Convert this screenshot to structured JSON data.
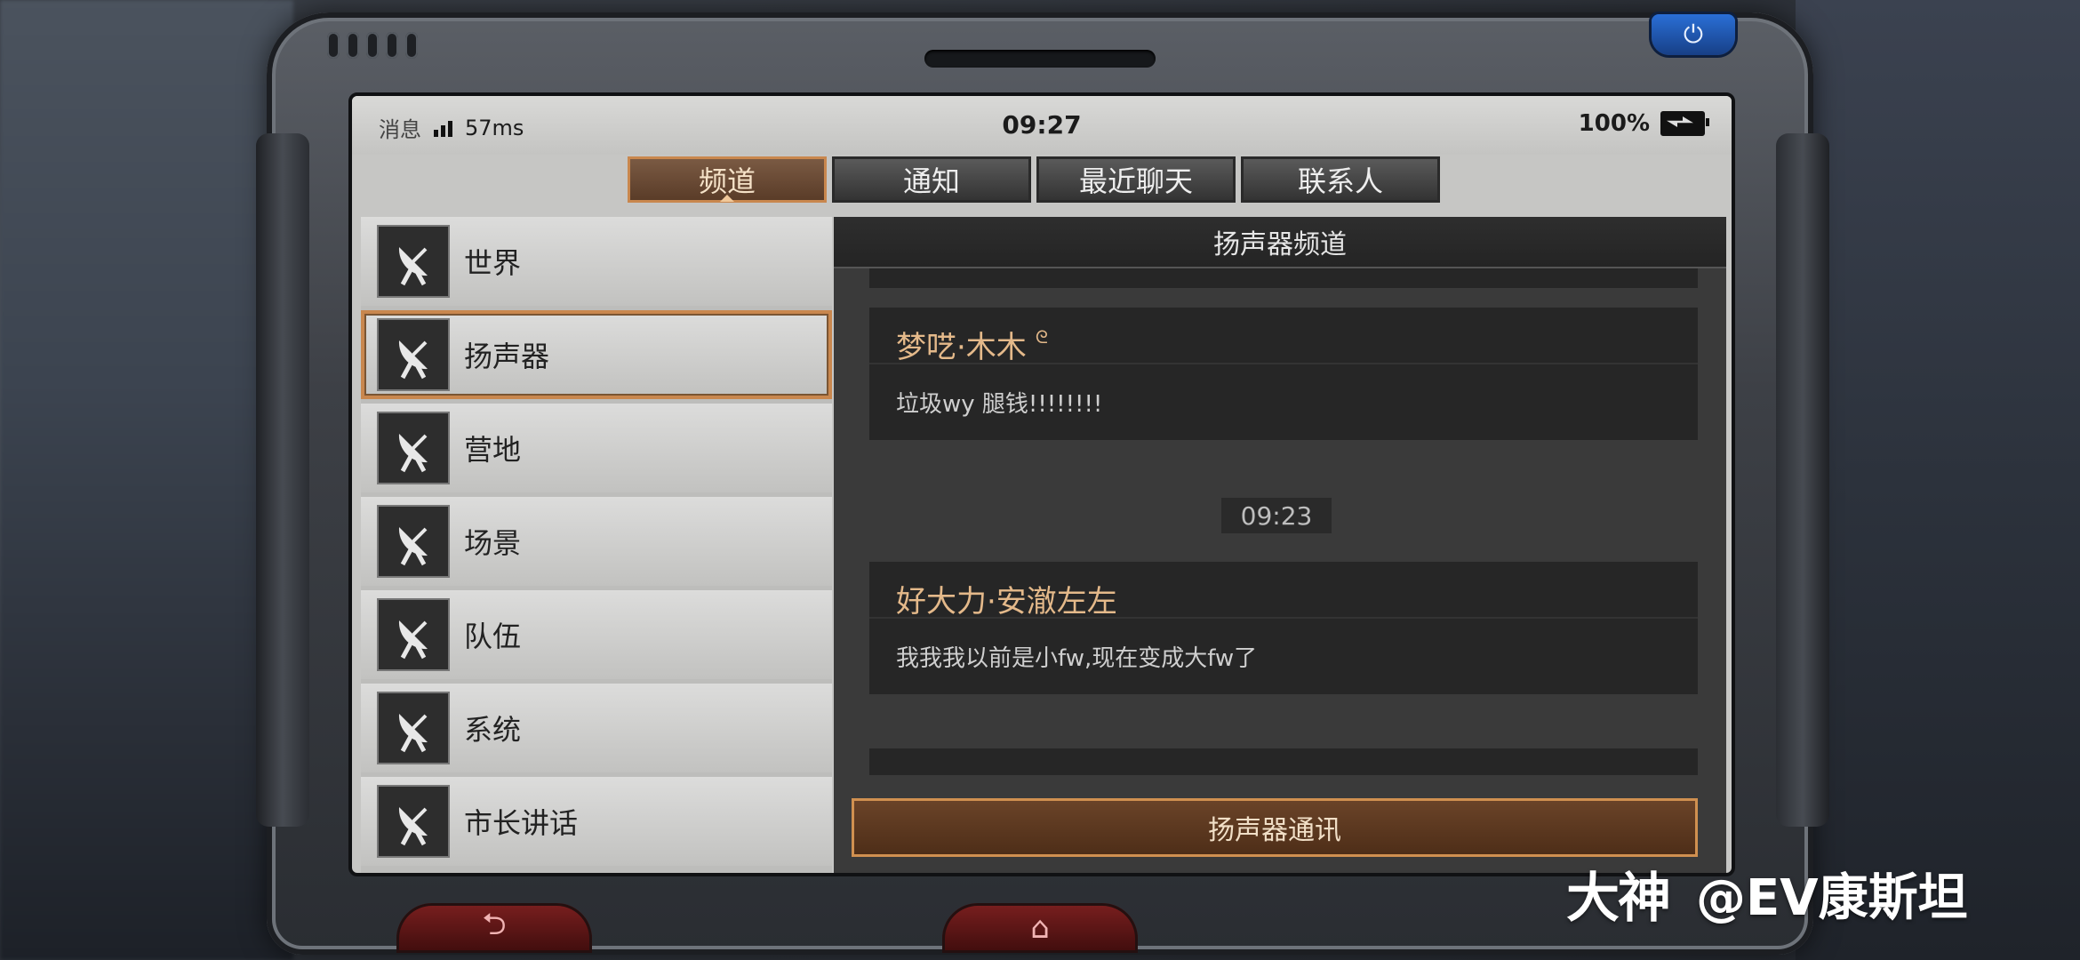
{
  "status_bar": {
    "label": "消息",
    "ping": "57ms",
    "time": "09:27",
    "battery": "100%"
  },
  "tabs": [
    {
      "label": "频道",
      "active": true
    },
    {
      "label": "通知",
      "active": false
    },
    {
      "label": "最近聊天",
      "active": false
    },
    {
      "label": "联系人",
      "active": false
    }
  ],
  "channels": [
    {
      "label": "世界",
      "icon": "radar-dish-icon",
      "active": false
    },
    {
      "label": "扬声器",
      "icon": "radar-dish-icon",
      "active": true
    },
    {
      "label": "营地",
      "icon": "radar-dish-icon",
      "active": false
    },
    {
      "label": "场景",
      "icon": "radar-dish-icon",
      "active": false
    },
    {
      "label": "队伍",
      "icon": "radar-dish-icon",
      "active": false
    },
    {
      "label": "系统",
      "icon": "radar-dish-icon",
      "active": false
    },
    {
      "label": "市长讲话",
      "icon": "radar-dish-icon",
      "active": false
    }
  ],
  "chat": {
    "header": "扬声器频道",
    "messages": [
      {
        "name": "梦呓·木木",
        "badge": "ᘓ",
        "text": "垃圾wy 腿钱!!!!!!!!"
      },
      {
        "name": "好大力·安澈左左",
        "text": "我我我以前是小fw,现在变成大fw了"
      }
    ],
    "time_separator": "09:23",
    "send_button": "扬声器通讯"
  },
  "watermark": {
    "logo": "大神",
    "handle": "@EV康斯坦"
  },
  "colors": {
    "accent": "#c9874e",
    "name_color": "#e4b98a",
    "power_button": "#2a6fd6"
  }
}
